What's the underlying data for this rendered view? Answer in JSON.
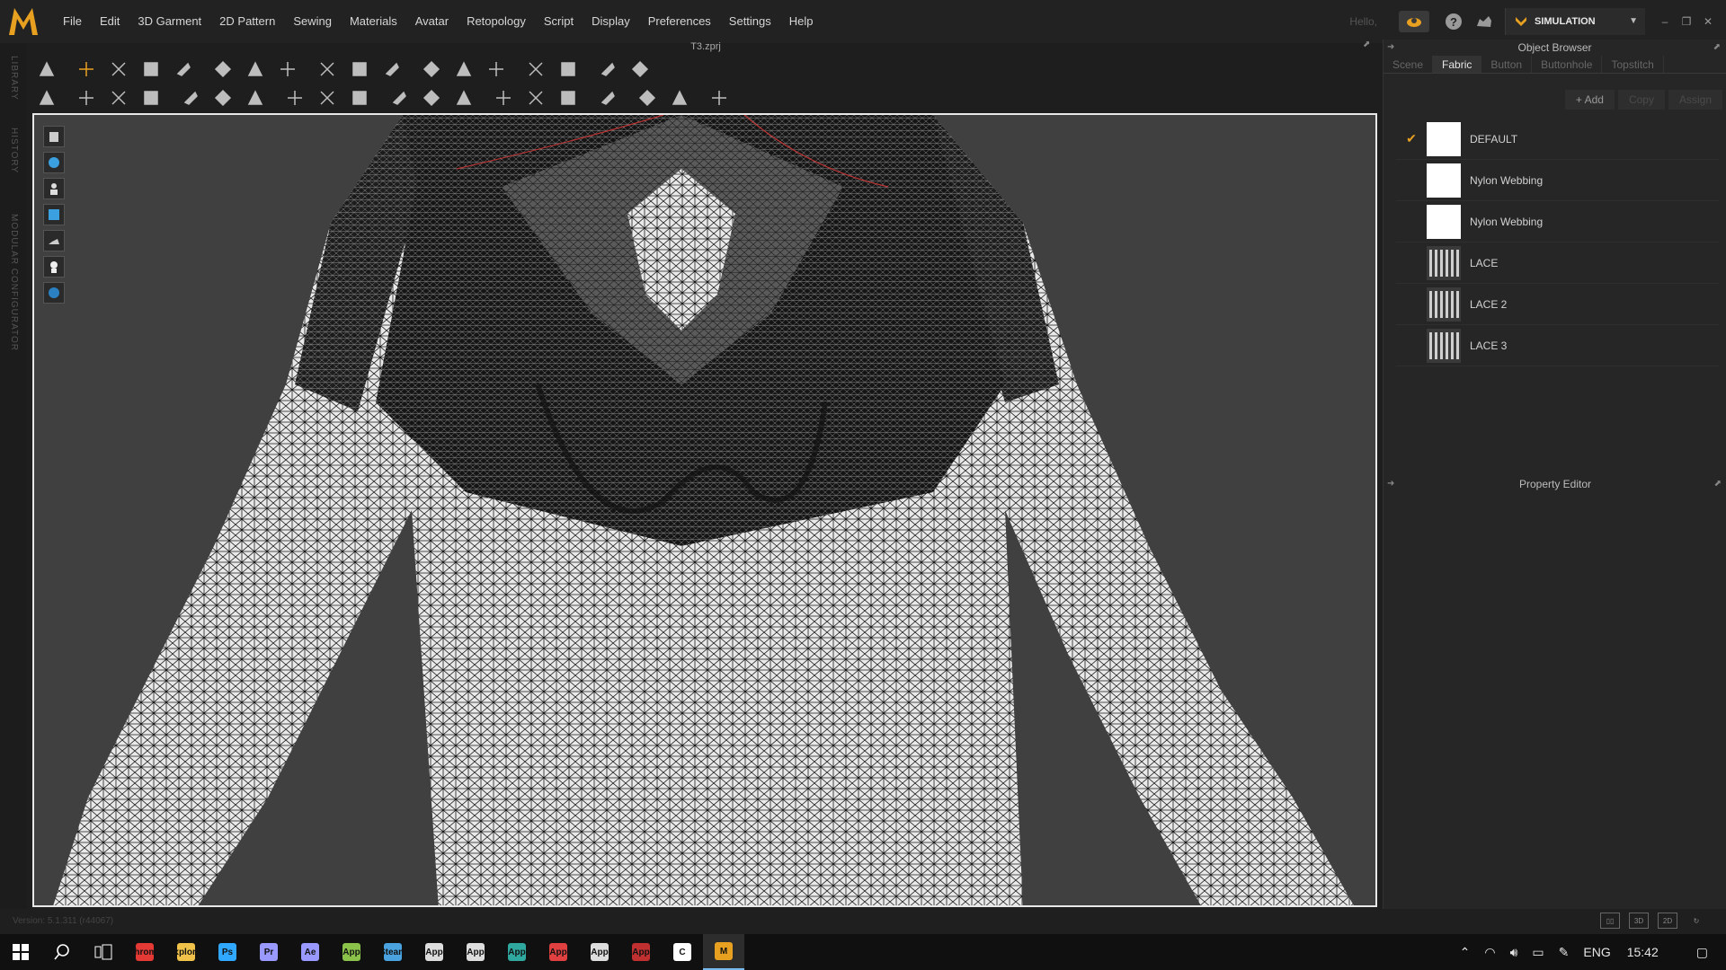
{
  "app": {
    "logo_letter": "M",
    "file_title": "T3.zprj",
    "hello_text": "Hello,",
    "mode_label": "SIMULATION",
    "version_text": "Version: 5.1.311 (r44067)"
  },
  "menu": [
    "File",
    "Edit",
    "3D Garment",
    "2D Pattern",
    "Sewing",
    "Materials",
    "Avatar",
    "Retopology",
    "Script",
    "Display",
    "Preferences",
    "Settings",
    "Help"
  ],
  "left_tabs": [
    "LIBRARY",
    "HISTORY",
    "MODULAR CONFIGURATOR"
  ],
  "object_browser": {
    "title": "Object Browser",
    "tabs": [
      "Scene",
      "Fabric",
      "Button",
      "Buttonhole",
      "Topstitch"
    ],
    "active_tab": "Fabric",
    "actions": {
      "add": "+ Add",
      "copy": "Copy",
      "assign": "Assign"
    },
    "fabrics": [
      {
        "name": "DEFAULT",
        "selected": true,
        "swatch": "white"
      },
      {
        "name": "Nylon Webbing",
        "selected": false,
        "swatch": "white"
      },
      {
        "name": "Nylon Webbing",
        "selected": false,
        "swatch": "white"
      },
      {
        "name": "LACE",
        "selected": false,
        "swatch": "lace"
      },
      {
        "name": "LACE 2",
        "selected": false,
        "swatch": "lace"
      },
      {
        "name": "LACE 3",
        "selected": false,
        "swatch": "lace"
      }
    ]
  },
  "property_editor": {
    "title": "Property Editor"
  },
  "view_modes": [
    "2D",
    "3D",
    "2D|3D"
  ],
  "taskbar": {
    "language": "ENG",
    "time": "15:42",
    "apps": [
      "Chrome",
      "Explorer",
      "Ps",
      "Pr",
      "Ae",
      "App",
      "Steam",
      "App",
      "App",
      "App",
      "App",
      "App",
      "App",
      "C",
      "M"
    ]
  },
  "colors": {
    "accent": "#e8a020",
    "viewport_bg": "#404040",
    "panel_bg": "#262626"
  }
}
